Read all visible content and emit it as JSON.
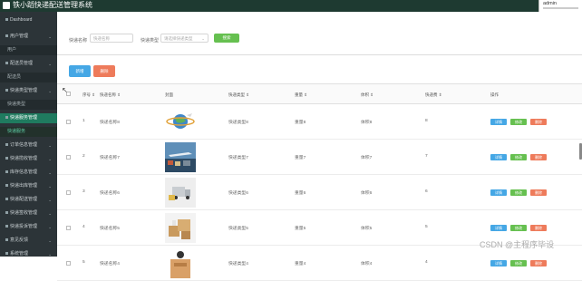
{
  "app": {
    "title": "铁小蹈快递配送管理系统",
    "user": "admin"
  },
  "colors": {
    "topbar": "#1e3a31",
    "sidebar": "#2c3438",
    "active": "#1f7b5f",
    "search": "#66c050",
    "add": "#45a7e5",
    "delete": "#ee7b5b",
    "detail": "#45a7e5",
    "edit": "#66c050",
    "remove": "#ee7b5b"
  },
  "sidebar": {
    "items": [
      {
        "label": "Dashboard",
        "type": "item",
        "icon": "dashboard-icon"
      },
      {
        "label": "用户管理",
        "type": "item",
        "icon": "user-icon"
      },
      {
        "label": "用户",
        "type": "sub"
      },
      {
        "label": "配送员管理",
        "type": "item",
        "icon": "folder-icon"
      },
      {
        "label": "配送员",
        "type": "sub"
      },
      {
        "label": "快递类型管理",
        "type": "item",
        "icon": "folder-icon"
      },
      {
        "label": "快递类型",
        "type": "sub"
      },
      {
        "label": "快递服务管理",
        "type": "active",
        "icon": "folder-icon"
      },
      {
        "label": "快递服务",
        "type": "activesub"
      },
      {
        "label": "订单信息管理",
        "type": "item",
        "icon": "cart-icon"
      },
      {
        "label": "快递揽收管理",
        "type": "item",
        "icon": "folder-icon"
      },
      {
        "label": "库存信息管理",
        "type": "item",
        "icon": "folder-icon"
      },
      {
        "label": "快递出库管理",
        "type": "item",
        "icon": "folder-icon"
      },
      {
        "label": "快递配送管理",
        "type": "item",
        "icon": "folder-icon"
      },
      {
        "label": "快递签收管理",
        "type": "item",
        "icon": "folder-icon"
      },
      {
        "label": "快递投诉管理",
        "type": "item",
        "icon": "folder-icon"
      },
      {
        "label": "意见反馈",
        "type": "item",
        "icon": "flag-icon"
      },
      {
        "label": "系统管理",
        "type": "item",
        "icon": "gear-icon"
      }
    ]
  },
  "filters": {
    "name_label": "快递名称",
    "name_placeholder": "快递名称",
    "type_label": "快递类型",
    "type_placeholder": "请选择快递类型",
    "search_label": "搜索"
  },
  "actions": {
    "add": "新增",
    "delete": "删除"
  },
  "table": {
    "headers": [
      "序号",
      "快递名称",
      "封面",
      "快递类型",
      "重量",
      "体积",
      "快递费",
      "操作"
    ],
    "row_actions": {
      "detail": "详情",
      "edit": "修改",
      "delete": "删除"
    },
    "rows": [
      {
        "index": "1",
        "name": "快递名称8",
        "type": "快递类型8",
        "weight": "重量8",
        "volume": "体积8",
        "fee": "8",
        "image": "globe"
      },
      {
        "index": "2",
        "name": "快递名称7",
        "type": "快递类型7",
        "weight": "重量7",
        "volume": "体积7",
        "fee": "7",
        "image": "airport"
      },
      {
        "index": "3",
        "name": "快递名称6",
        "type": "快递类型6",
        "weight": "重量6",
        "volume": "体积6",
        "fee": "6",
        "image": "truck"
      },
      {
        "index": "4",
        "name": "快递名称5",
        "type": "快递类型5",
        "weight": "重量5",
        "volume": "体积5",
        "fee": "5",
        "image": "boxes"
      },
      {
        "index": "5",
        "name": "快递名称4",
        "type": "快递类型4",
        "weight": "重量4",
        "volume": "体积4",
        "fee": "4",
        "image": "courier"
      }
    ]
  },
  "watermark": "CSDN @主程序毕设"
}
